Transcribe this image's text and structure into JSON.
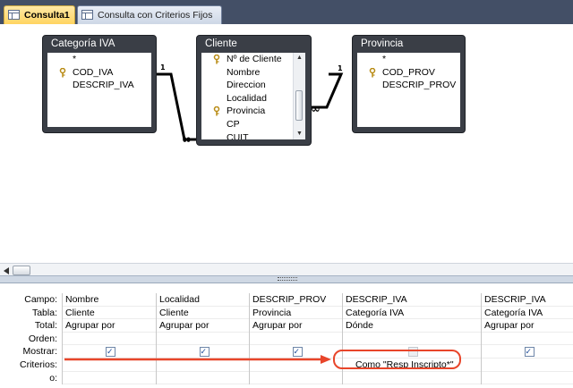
{
  "tabs": [
    {
      "label": "Consulta1",
      "active": true
    },
    {
      "label": "Consulta con Criterios Fijos",
      "active": false
    }
  ],
  "tables": {
    "categoria": {
      "title": "Categoría IVA",
      "fields": [
        "*",
        "COD_IVA",
        "DESCRIP_IVA"
      ],
      "key_field": "COD_IVA"
    },
    "cliente": {
      "title": "Cliente",
      "fields": [
        "Nº de Cliente",
        "Nombre",
        "Direccion",
        "Localidad",
        "Provincia",
        "CP",
        "CUIT"
      ],
      "key_fields": [
        "Nº de Cliente",
        "Provincia"
      ]
    },
    "provincia": {
      "title": "Provincia",
      "fields": [
        "*",
        "COD_PROV",
        "DESCRIP_PROV"
      ],
      "key_field": "COD_PROV"
    }
  },
  "relations": [
    {
      "from": "Categoría IVA",
      "to": "Cliente",
      "one_label": "1",
      "many_label": "∞"
    },
    {
      "from": "Provincia",
      "to": "Cliente",
      "one_label": "1",
      "many_label": "∞"
    }
  ],
  "grid": {
    "row_labels": [
      "Campo:",
      "Tabla:",
      "Total:",
      "Orden:",
      "Mostrar:",
      "Criterios:",
      "o:"
    ],
    "columns": [
      {
        "campo": "Nombre",
        "tabla": "Cliente",
        "total": "Agrupar por",
        "orden": "",
        "mostrar": true,
        "criterios": "",
        "o": ""
      },
      {
        "campo": "Localidad",
        "tabla": "Cliente",
        "total": "Agrupar por",
        "orden": "",
        "mostrar": true,
        "criterios": "",
        "o": ""
      },
      {
        "campo": "DESCRIP_PROV",
        "tabla": "Provincia",
        "total": "Agrupar por",
        "orden": "",
        "mostrar": true,
        "criterios": "",
        "o": ""
      },
      {
        "campo": "DESCRIP_IVA",
        "tabla": "Categoría IVA",
        "total": "Dónde",
        "orden": "",
        "mostrar": false,
        "criterios": "Como \"Resp Inscripto*\"",
        "o": ""
      },
      {
        "campo": "DESCRIP_IVA",
        "tabla": "Categoría IVA",
        "total": "Agrupar por",
        "orden": "",
        "mostrar": true,
        "criterios": "",
        "o": ""
      }
    ]
  },
  "annotation": {
    "color": "#e8452a"
  }
}
